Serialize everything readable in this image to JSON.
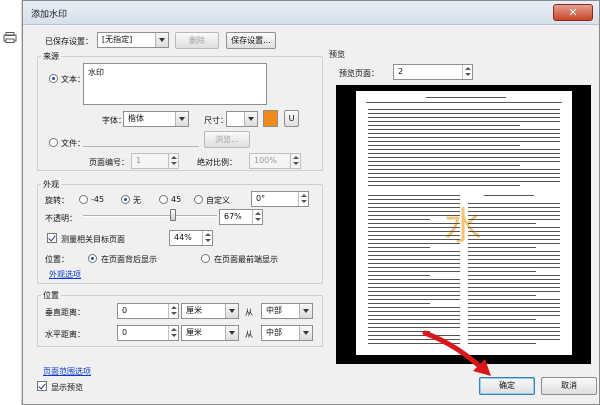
{
  "dialog": {
    "title": "添加水印",
    "close_glyph": "✕"
  },
  "settings": {
    "label": "已保存设置：",
    "selected": "[无指定]",
    "delete_label": "删除",
    "save_label": "保存设置..."
  },
  "source": {
    "group_title": "来源",
    "text_radio_label": "文本：",
    "text_value": "水印",
    "font_label": "字体：",
    "font_value": "楷体",
    "size_label": "尺寸：",
    "size_value": "",
    "underline_label": "U",
    "color_hex": "#f08a1a",
    "file_radio_label": "文件：",
    "browse_label": "浏览...",
    "page_number_label": "页面编号：",
    "page_number_value": "1",
    "absolute_scale_label": "绝对比例：",
    "absolute_scale_value": "100%"
  },
  "appearance": {
    "group_title": "外观",
    "rotation_label": "旋转：",
    "rot_minus45": "-45",
    "rot_none": "无",
    "rot_45": "45",
    "rot_custom": "自定义",
    "rot_custom_value": "0°",
    "opacity_label": "不透明：",
    "opacity_value": "67%",
    "opacity_level": 0.67,
    "relative_scale_label": "测量相关目标页面",
    "relative_scale_value": "44%",
    "position_label": "位置：",
    "behind_label": "在页面背后显示",
    "front_label": "在页面最前端显示",
    "more_options_link": "外观选项"
  },
  "position": {
    "group_title": "位置",
    "vertical_label": "垂直距离：",
    "vertical_value": "0",
    "vertical_unit": "厘米",
    "vertical_from": "从",
    "vertical_anchor": "中部",
    "horizontal_label": "水平距离：",
    "horizontal_value": "0",
    "horizontal_unit": "厘米",
    "horizontal_from": "从",
    "horizontal_anchor": "中部"
  },
  "footer": {
    "page_range_link": "页面范围选项",
    "show_preview_label": "显示预览",
    "ok_label": "确定",
    "cancel_label": "取消"
  },
  "preview": {
    "group_title": "预览",
    "page_label": "预览页面：",
    "page_value": "2",
    "watermark_glyph": "水",
    "watermark_color": "#f0b04a",
    "arrow_color": "#d81818"
  },
  "colors": {
    "accent": "#1a55a8",
    "link": "#0a3bd6"
  }
}
